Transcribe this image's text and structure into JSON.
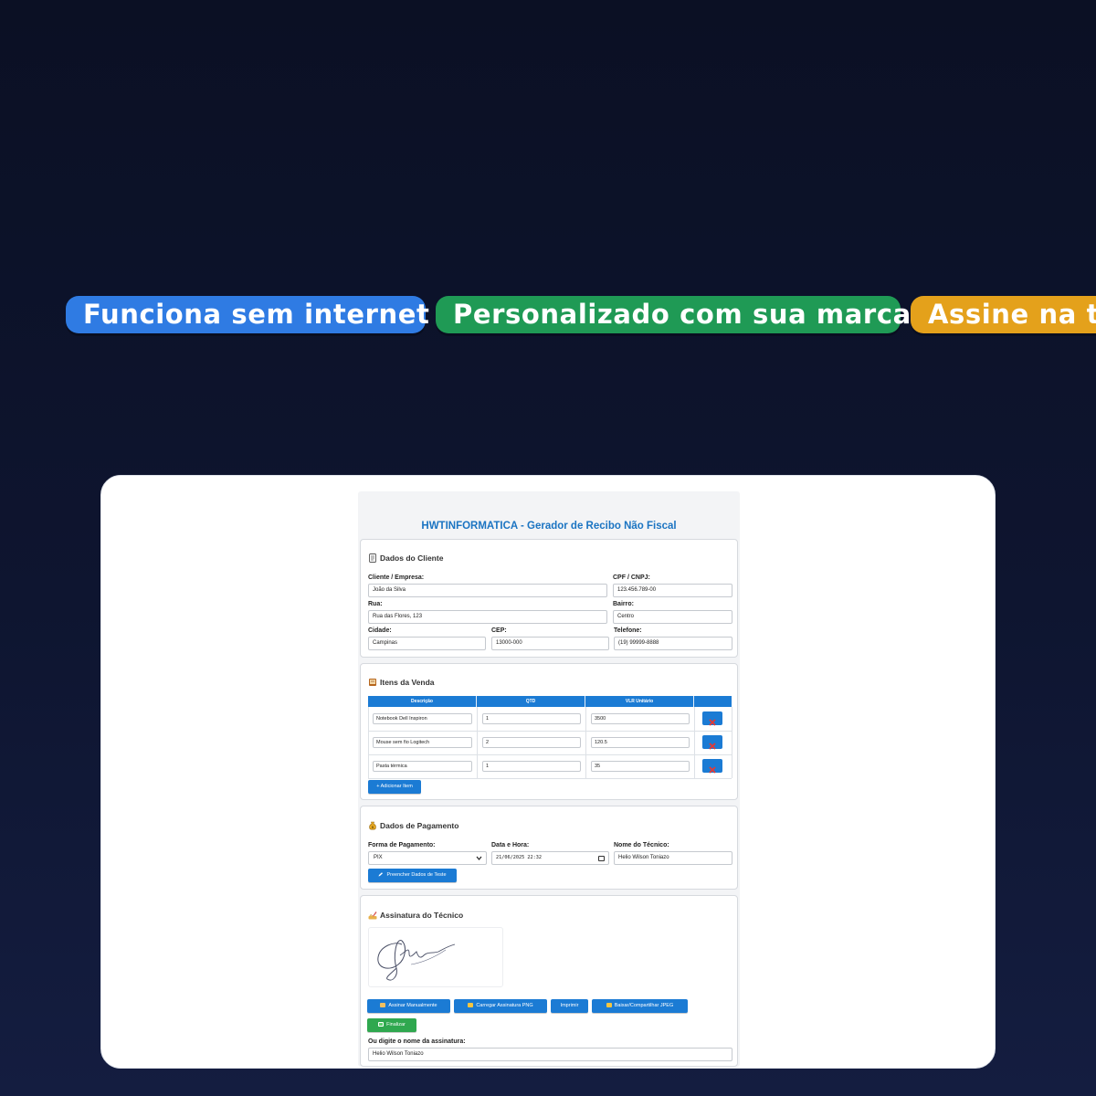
{
  "banner": {
    "pills": [
      "Funciona sem internet",
      "Personalizado com sua marca",
      "Assine na te"
    ],
    "colors": [
      "#2f7be3",
      "#1f9a55",
      "#e4a11b"
    ]
  },
  "app": {
    "title": "HWTINFORMATICA - Gerador de Recibo Não Fiscal",
    "accent": "#1b7bd4",
    "client": {
      "title": "Dados do Cliente",
      "icon": "document-icon",
      "fields": {
        "cliente_label": "Cliente / Empresa:",
        "cliente_value": "João da Silva",
        "cpf_label": "CPF / CNPJ:",
        "cpf_value": "123.456.789-00",
        "rua_label": "Rua:",
        "rua_value": "Rua das Flores, 123",
        "bairro_label": "Bairro:",
        "bairro_value": "Centro",
        "cidade_label": "Cidade:",
        "cidade_value": "Campinas",
        "cep_label": "CEP:",
        "cep_value": "13000-000",
        "telefone_label": "Telefone:",
        "telefone_value": "(19) 99999-8888"
      }
    },
    "items": {
      "title": "Itens da Venda",
      "icon": "book-icon",
      "headers": [
        "Descrição",
        "QTD",
        "VLR Unitário"
      ],
      "rows": [
        {
          "desc": "Notebook Dell Inspiron",
          "qtd": "1",
          "vlr": "3500"
        },
        {
          "desc": "Mouse sem fio Logitech",
          "qtd": "2",
          "vlr": "120.5"
        },
        {
          "desc": "Pasta térmica",
          "qtd": "1",
          "vlr": "35"
        }
      ],
      "add_label": "+ Adicionar Item"
    },
    "payment": {
      "title": "Dados de Pagamento",
      "icon": "money-bag-icon",
      "forma_label": "Forma de Pagamento:",
      "forma_value": "PIX",
      "data_label": "Data e Hora:",
      "data_value": "21/06/2025 22:32",
      "tecnico_label": "Nome do Técnico:",
      "tecnico_value": "Helio Wilson Toniazo",
      "fill_label": "Preencher Dados de Teste"
    },
    "signature": {
      "title": "Assinatura do Técnico",
      "icon": "writing-hand-icon",
      "buttons": [
        "Assinar Manualmente",
        "Carregar Assinatura PNG",
        "Imprimir",
        "Baixar/Compartilhar JPEG"
      ],
      "finalize_label": "Finalizar",
      "typed_label": "Ou digite o nome da assinatura:",
      "typed_value": "Helio Wilson Toniazo"
    }
  }
}
